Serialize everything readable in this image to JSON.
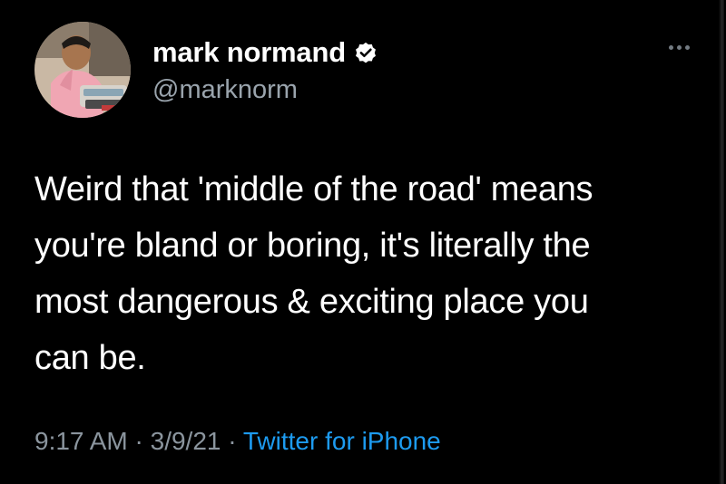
{
  "tweet": {
    "author": {
      "display_name": "mark normand",
      "handle": "@marknorm",
      "verified": true,
      "verified_icon": "verified-badge-icon"
    },
    "more_icon": "more-options-icon",
    "text": "Weird that 'middle of the road' means\nyou're bland or boring, it's literally the\nmost dangerous & exciting place you\ncan be.",
    "meta": {
      "time": "9:17 AM",
      "separator": " · ",
      "date": "3/9/21",
      "source": "Twitter for iPhone"
    }
  },
  "colors": {
    "background": "#000000",
    "text": "#ffffff",
    "secondary": "#8b959e",
    "link": "#1d9bf0",
    "verified_badge": "#ffffff"
  }
}
